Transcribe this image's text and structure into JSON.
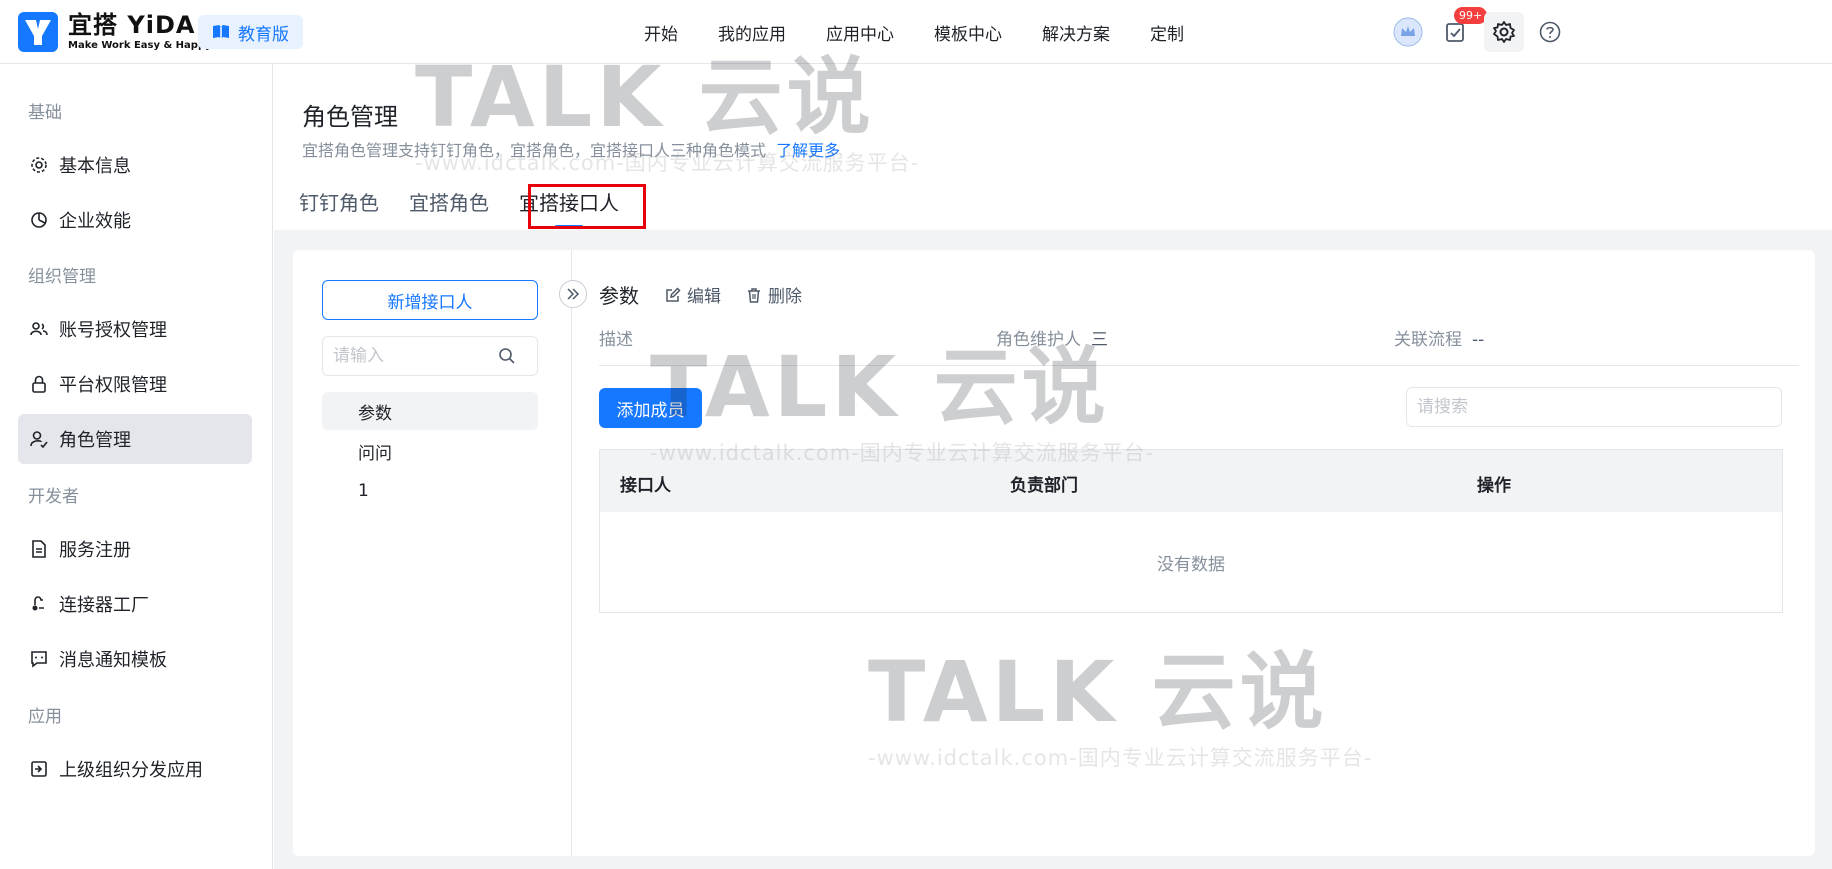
{
  "brand": {
    "name": "宜搭 YiDA",
    "slogan": "Make Work Easy & Happy",
    "edition": "教育版"
  },
  "nav": [
    "开始",
    "我的应用",
    "应用中心",
    "模板中心",
    "解决方案",
    "定制"
  ],
  "topbar": {
    "notification_badge": "99+"
  },
  "sidebar": {
    "groups": [
      "基础",
      "组织管理",
      "开发者",
      "应用"
    ],
    "items": [
      "基本信息",
      "企业效能",
      "账号授权管理",
      "平台权限管理",
      "角色管理",
      "服务注册",
      "连接器工厂",
      "消息通知模板",
      "上级组织分发应用"
    ]
  },
  "page": {
    "title": "角色管理",
    "description": "宜搭角色管理支持钉钉角色，宜搭角色，宜搭接口人三种角色模式",
    "learn_more": "了解更多",
    "tabs": [
      "钉钉角色",
      "宜搭角色",
      "宜搭接口人"
    ]
  },
  "left_panel": {
    "add_button": "新增接口人",
    "search_placeholder": "请输入",
    "roles": [
      "参数",
      "问问",
      "1"
    ]
  },
  "detail": {
    "title": "参数",
    "edit": "编辑",
    "delete": "删除",
    "meta": [
      {
        "label": "描述",
        "value": ""
      },
      {
        "label": "角色维护人",
        "value": "三"
      },
      {
        "label": "关联流程",
        "value": "--"
      }
    ],
    "add_member": "添加成员",
    "search_placeholder": "请搜索",
    "columns": [
      "接口人",
      "负责部门",
      "操作"
    ],
    "empty_text": "没有数据"
  },
  "watermark": {
    "brand": "TALK 云说",
    "url": "-www.idctalk.com-国内专业云计算交流服务平台-"
  },
  "colors": {
    "primary": "#1677ff",
    "highlight_box": "#e8000b",
    "badge": "#f53f3f"
  }
}
